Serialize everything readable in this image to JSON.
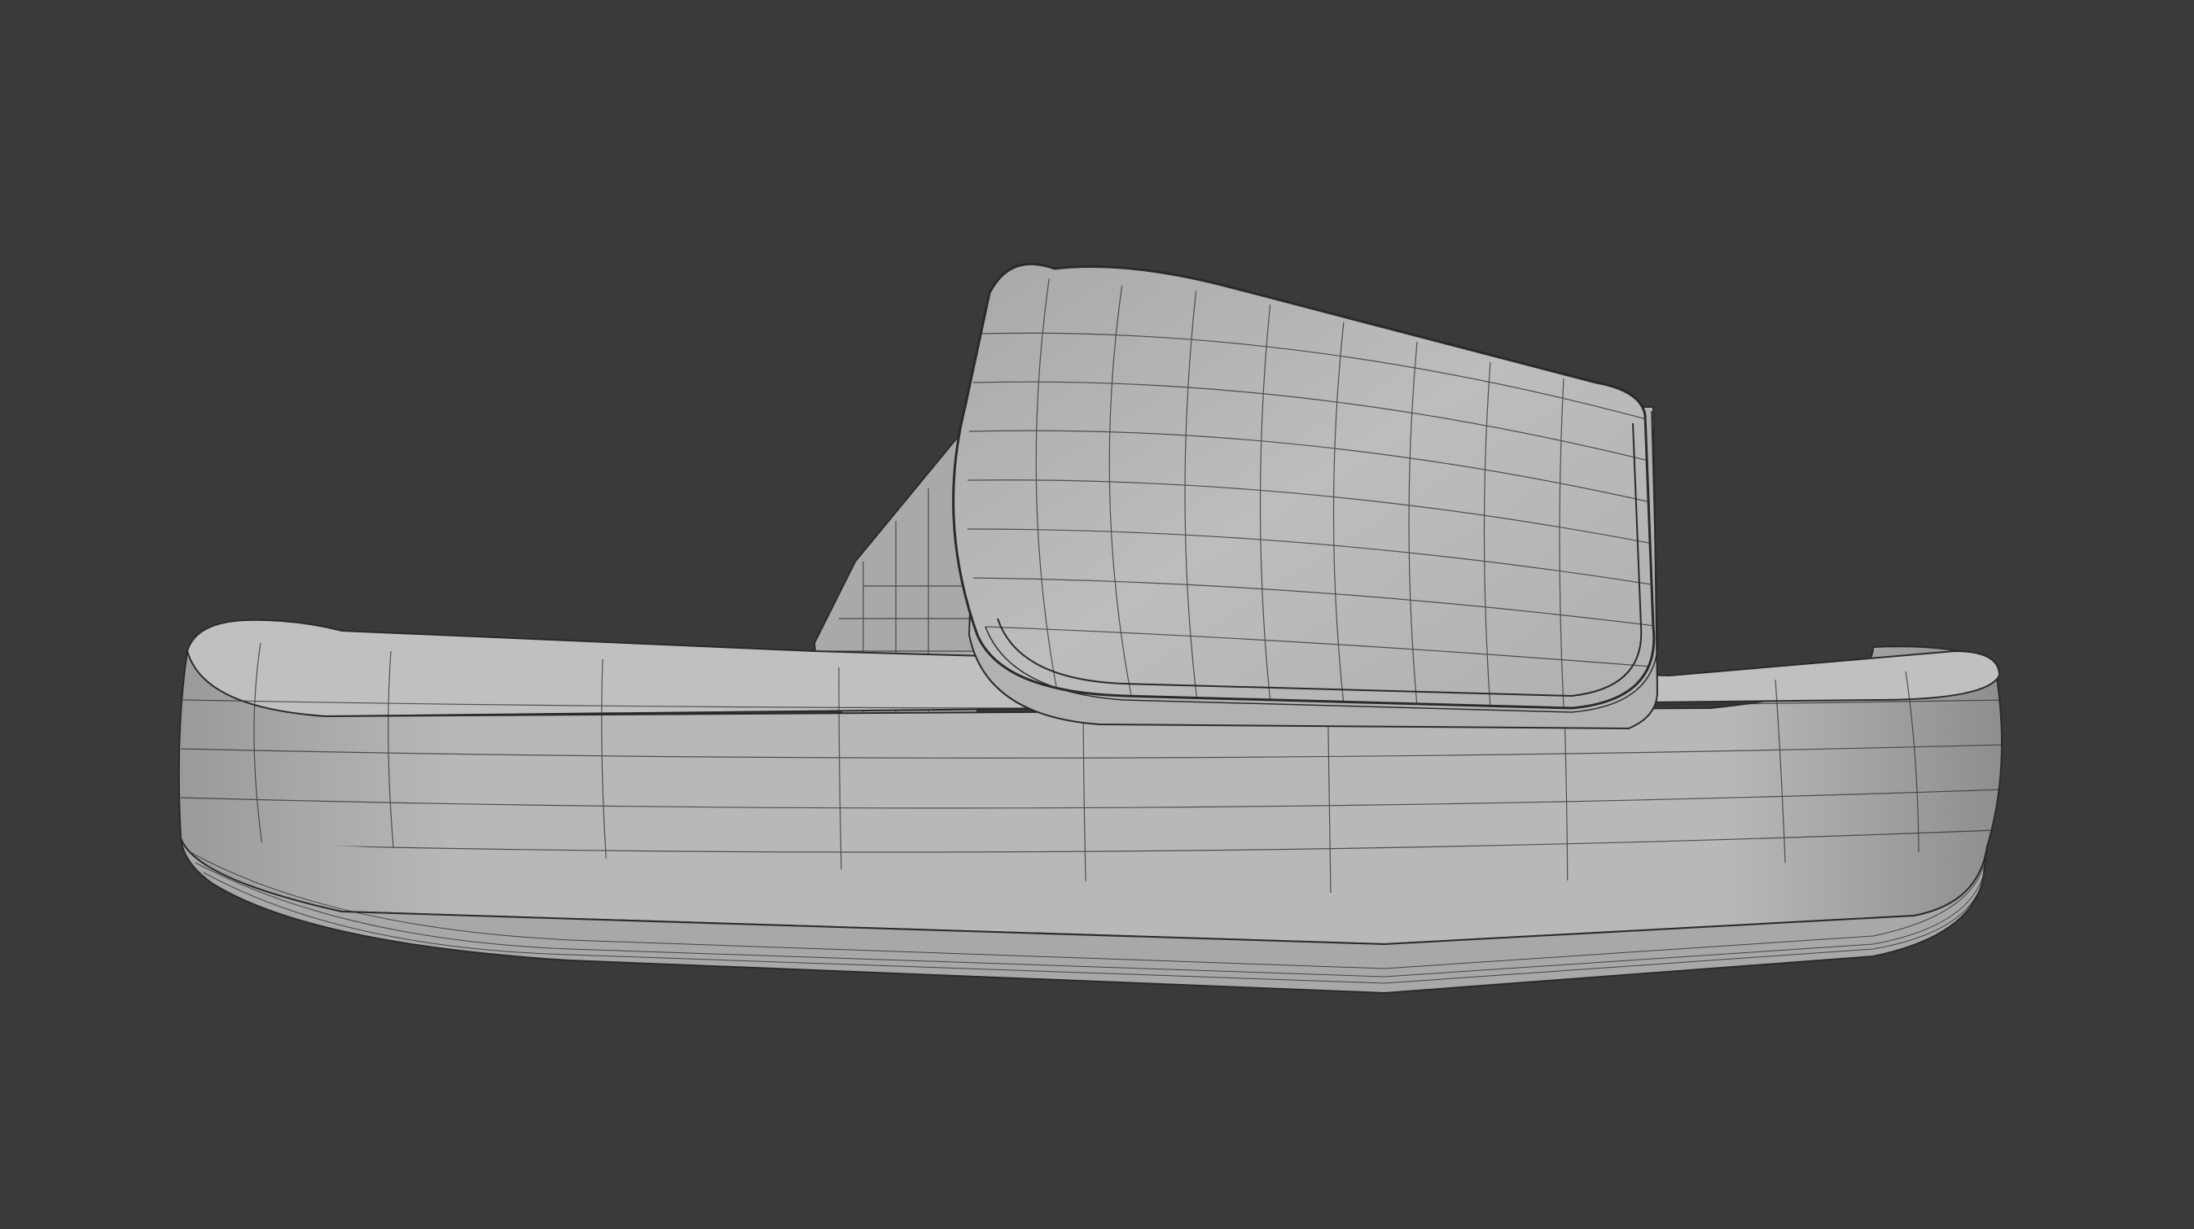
{
  "viewport": {
    "background_color": "#3a3a3a",
    "model_color": "#b4b4b4",
    "wire_color": "#2a2a2a",
    "object": "slide-sandal-mesh",
    "shading": "solid-with-wireframe"
  }
}
